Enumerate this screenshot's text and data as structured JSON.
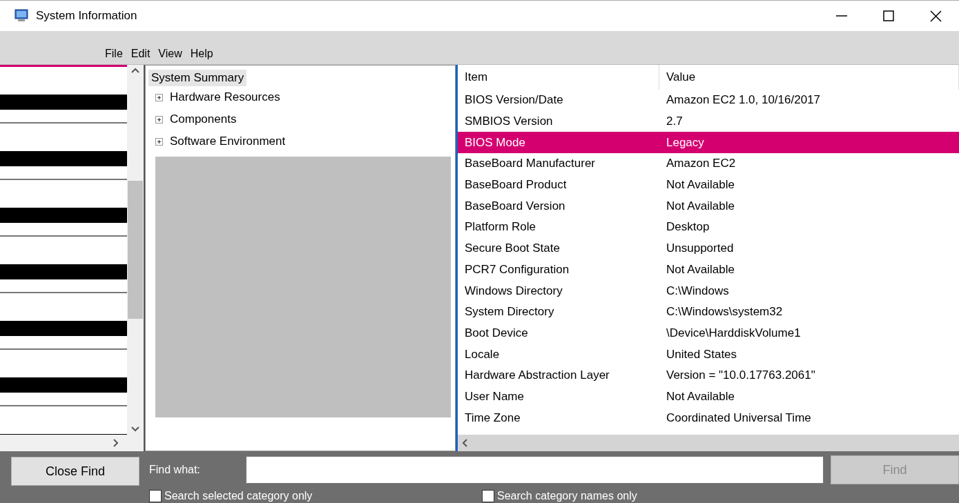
{
  "window": {
    "title": "System Information"
  },
  "menu": [
    "File",
    "Edit",
    "View",
    "Help"
  ],
  "tree": {
    "root": {
      "label": "System Summary",
      "selected": true,
      "children": [
        {
          "label": "Hardware Resources",
          "expanded": false,
          "selected": false
        },
        {
          "label": "Components",
          "expanded": false,
          "selected": false
        },
        {
          "label": "Software Environment",
          "expanded": false,
          "selected": false
        }
      ]
    }
  },
  "table": {
    "columns": [
      "Item",
      "Value"
    ],
    "rows": [
      {
        "item": "BIOS Version/Date",
        "value": "Amazon EC2 1.0, 10/16/2017",
        "selected": false
      },
      {
        "item": "SMBIOS Version",
        "value": "2.7",
        "selected": false
      },
      {
        "item": "BIOS Mode",
        "value": "Legacy",
        "selected": true
      },
      {
        "item": "BaseBoard Manufacturer",
        "value": "Amazon EC2",
        "selected": false
      },
      {
        "item": "BaseBoard Product",
        "value": "Not Available",
        "selected": false
      },
      {
        "item": "BaseBoard Version",
        "value": "Not Available",
        "selected": false
      },
      {
        "item": "Platform Role",
        "value": "Desktop",
        "selected": false
      },
      {
        "item": "Secure Boot State",
        "value": "Unsupported",
        "selected": false
      },
      {
        "item": "PCR7 Configuration",
        "value": "Not Available",
        "selected": false
      },
      {
        "item": "Windows Directory",
        "value": "C:\\Windows",
        "selected": false
      },
      {
        "item": "System Directory",
        "value": "C:\\Windows\\system32",
        "selected": false
      },
      {
        "item": "Boot Device",
        "value": "\\Device\\HarddiskVolume1",
        "selected": false
      },
      {
        "item": "Locale",
        "value": "United States",
        "selected": false
      },
      {
        "item": "Hardware Abstraction Layer",
        "value": "Version = \"10.0.17763.2061\"",
        "selected": false
      },
      {
        "item": "User Name",
        "value": "Not Available",
        "selected": false
      },
      {
        "item": "Time Zone",
        "value": "Coordinated Universal Time",
        "selected": false
      }
    ]
  },
  "find_bar": {
    "close_button": "Close Find",
    "label": "Find what:",
    "find_button": {
      "label": "Find",
      "disabled": true
    },
    "options": [
      {
        "label": "Search selected category only",
        "checked": false
      },
      {
        "label": "Search category names only",
        "checked": false
      }
    ]
  }
}
